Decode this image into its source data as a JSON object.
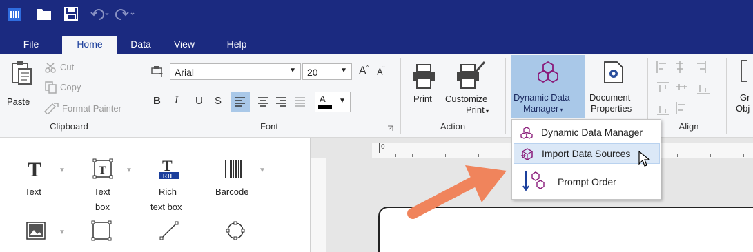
{
  "tabs": [
    {
      "label": "File"
    },
    {
      "label": "Home"
    },
    {
      "label": "Data"
    },
    {
      "label": "View"
    },
    {
      "label": "Help"
    }
  ],
  "clipboard": {
    "paste": "Paste",
    "cut": "Cut",
    "copy": "Copy",
    "format_painter": "Format Painter",
    "group": "Clipboard"
  },
  "font": {
    "family": "Arial",
    "size": "20",
    "grow": "A",
    "shrink": "A",
    "bold": "B",
    "italic": "I",
    "underline": "U",
    "strike": "S",
    "color_letter": "A",
    "group": "Font"
  },
  "action": {
    "print": "Print",
    "customize_1": "Customize",
    "customize_2": "Print",
    "group": "Action"
  },
  "ddm": {
    "line1": "Dynamic Data",
    "line2": "Manager",
    "doc1": "Document",
    "doc2": "Properties"
  },
  "align": {
    "group": "Align"
  },
  "cut_off": {
    "line1": "Gr",
    "line2": "Obj"
  },
  "menu": {
    "items": [
      {
        "label": "Dynamic Data Manager"
      },
      {
        "label": "Import Data Sources"
      },
      {
        "label": "Prompt Order"
      }
    ]
  },
  "tools": {
    "text": "Text",
    "textbox_1": "Text",
    "textbox_2": "box",
    "rich_1": "Rich",
    "rich_2": "text box",
    "barcode": "Barcode",
    "rtf_badge": "RTF"
  },
  "ruler": {
    "zero": "0"
  },
  "colors": {
    "titlebar": "#1b2a80",
    "accent": "#1b3f9c",
    "selected": "#a9c8e8",
    "arrow": "#f0845c"
  }
}
